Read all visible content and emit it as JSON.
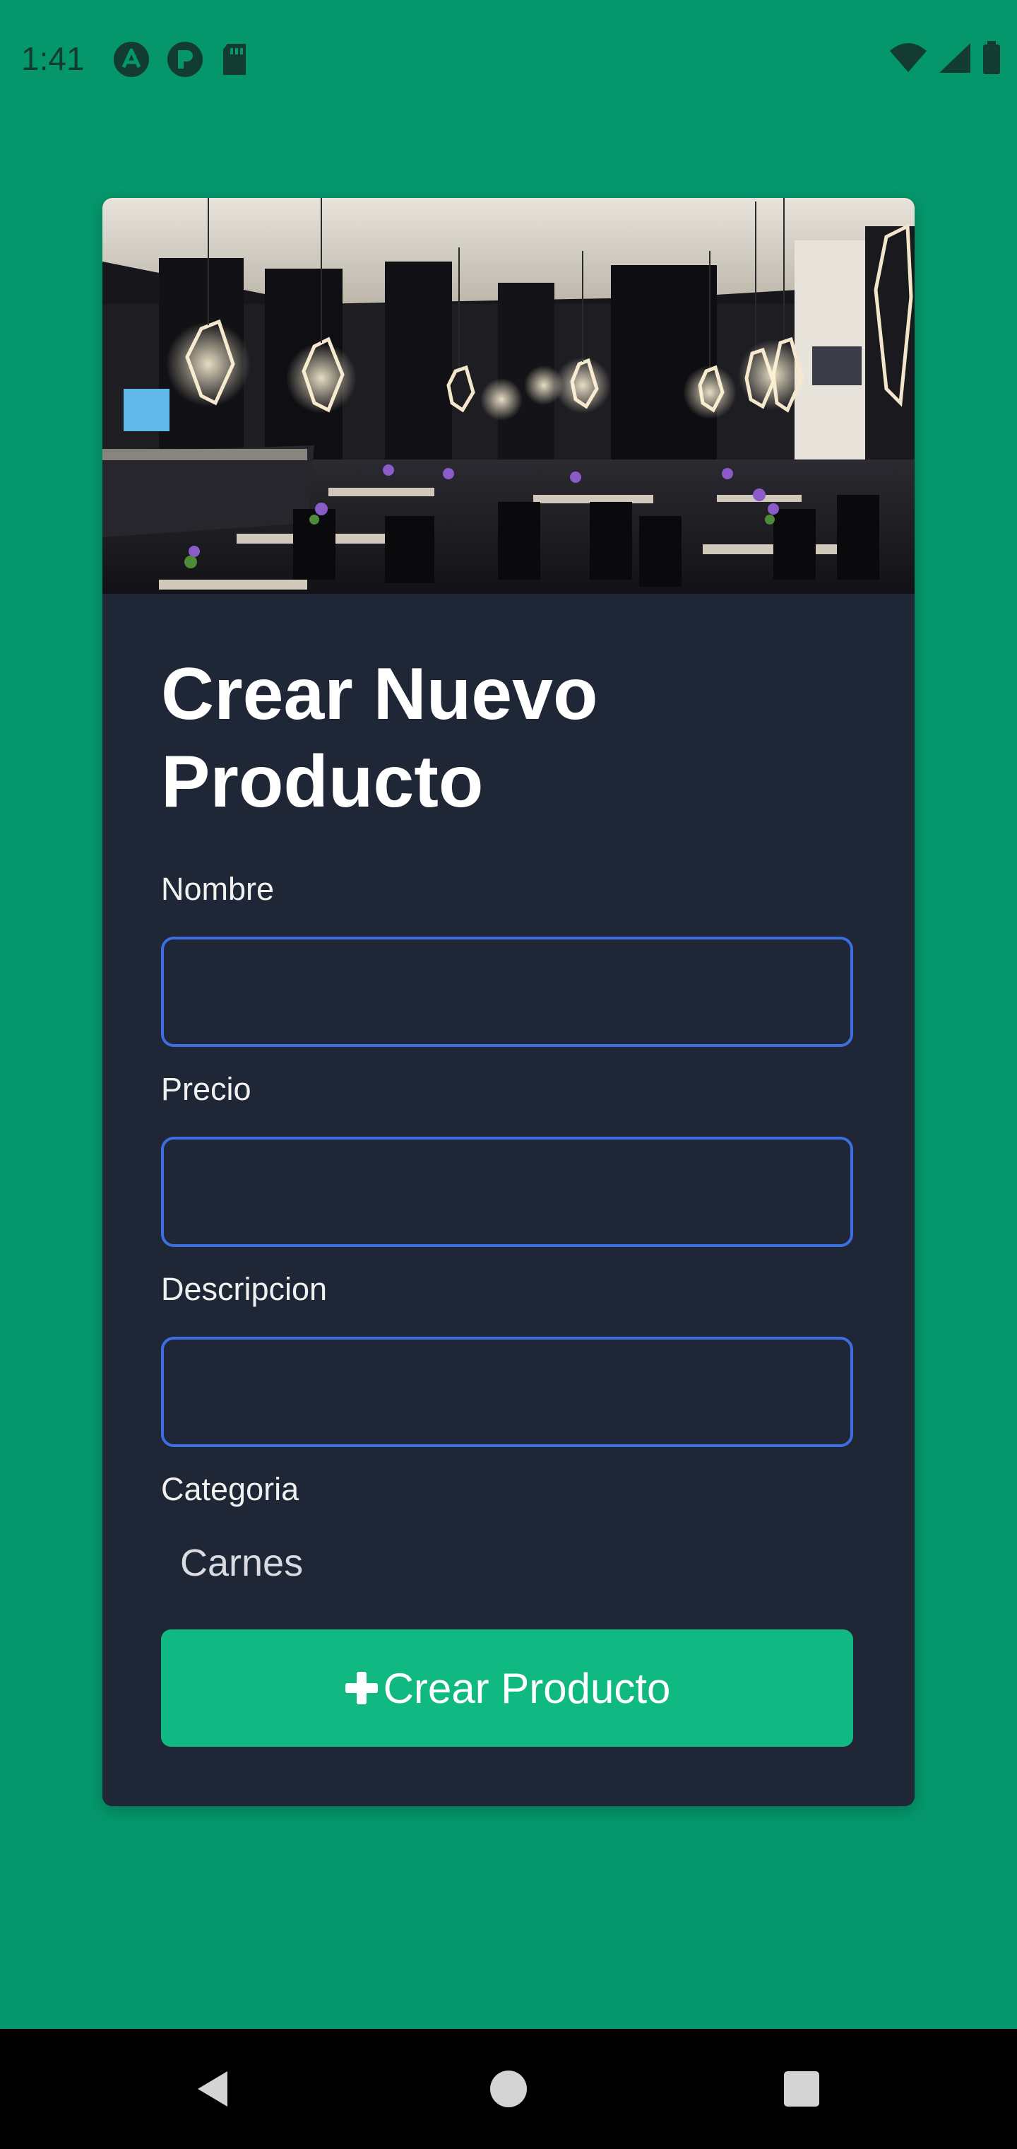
{
  "status_bar": {
    "time": "1:41",
    "left_icons": [
      "a-logo-icon",
      "p-logo-icon",
      "sd-card-icon"
    ],
    "right_icons": [
      "wifi-icon",
      "signal-icon",
      "battery-icon"
    ]
  },
  "colors": {
    "background": "#05966b",
    "card": "#1f2737",
    "input_border": "#3b6fe0",
    "button": "#10b981"
  },
  "form": {
    "title": "Crear Nuevo Producto",
    "fields": [
      {
        "label": "Nombre",
        "value": ""
      },
      {
        "label": "Precio",
        "value": ""
      },
      {
        "label": "Descripcion",
        "value": ""
      }
    ],
    "category": {
      "label": "Categoria",
      "selected": "Carnes"
    },
    "submit_label": "Crear Producto",
    "submit_icon": "plus-icon"
  },
  "nav_bar": {
    "buttons": [
      "back-icon",
      "home-icon",
      "recents-icon"
    ]
  }
}
